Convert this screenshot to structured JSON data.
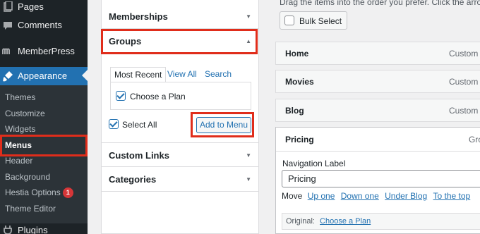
{
  "sidebar": {
    "top_items": [
      {
        "label": "Pages",
        "icon": "pages-icon"
      },
      {
        "label": "Comments",
        "icon": "comments-icon"
      },
      {
        "label": "MemberPress",
        "icon": "memberpress-icon"
      },
      {
        "label": "Appearance",
        "icon": "appearance-brush-icon"
      }
    ],
    "sub_items": [
      {
        "label": "Themes"
      },
      {
        "label": "Customize"
      },
      {
        "label": "Widgets"
      },
      {
        "label": "Menus"
      },
      {
        "label": "Header"
      },
      {
        "label": "Background"
      },
      {
        "label": "Hestia Options",
        "badge": "1"
      },
      {
        "label": "Theme Editor"
      }
    ],
    "bottom_item": {
      "label": "Plugins",
      "icon": "plugins-icon"
    }
  },
  "accordion": {
    "sections": [
      {
        "title": "Memberships",
        "state": "collapsed"
      },
      {
        "title": "Groups",
        "state": "expanded"
      },
      {
        "title": "Custom Links",
        "state": "collapsed"
      },
      {
        "title": "Categories",
        "state": "collapsed"
      }
    ],
    "tabs": [
      "Most Recent",
      "View All",
      "Search"
    ],
    "active_tab": "Most Recent",
    "item": {
      "label": "Choose a Plan",
      "checked": true
    },
    "select_all": {
      "label": "Select All",
      "checked": true
    },
    "add_button": "Add to Menu"
  },
  "structure": {
    "instruction": "Drag the items into the order you prefer. Click the arrow on t",
    "bulk_select": "Bulk Select",
    "items": [
      {
        "title": "Home",
        "type": "Custom Li"
      },
      {
        "title": "Movies",
        "type": "Custom Li"
      },
      {
        "title": "Blog",
        "type": "Custom Li"
      }
    ],
    "expanded_item": {
      "title": "Pricing",
      "type": "Gro",
      "nav_label_caption": "Navigation Label",
      "nav_label_value": "Pricing",
      "move_label": "Move",
      "move_links": [
        "Up one",
        "Down one",
        "Under Blog",
        "To the top"
      ],
      "original_label": "Original:",
      "original_link": "Choose a Plan"
    }
  },
  "colors": {
    "sidebar_bg": "#1d2327",
    "active_blue": "#2271b1",
    "highlight_red": "#e02d1b",
    "badge_red": "#d63638"
  }
}
